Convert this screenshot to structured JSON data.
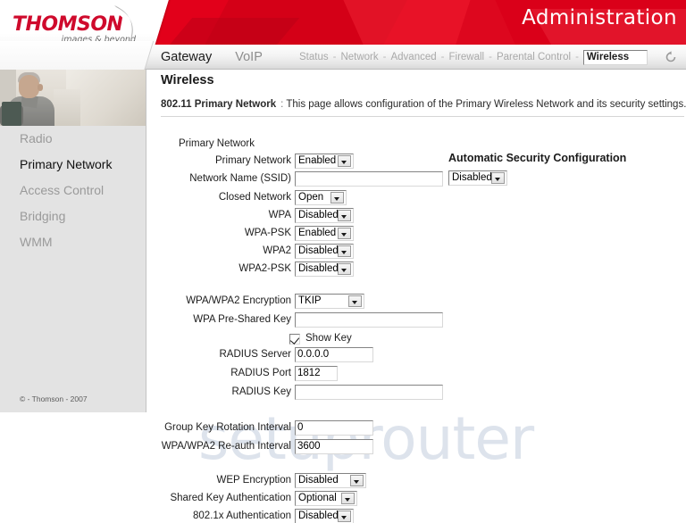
{
  "banner": {
    "logo_word": "THOMSON",
    "logo_tagline": "images & beyond",
    "title": "Administration"
  },
  "nav": {
    "primary": [
      {
        "label": "Gateway",
        "active": true
      },
      {
        "label": "VoIP",
        "active": false
      }
    ],
    "sub": [
      {
        "label": "Status",
        "selected": false
      },
      {
        "label": "Network",
        "selected": false
      },
      {
        "label": "Advanced",
        "selected": false
      },
      {
        "label": "Firewall",
        "selected": false
      },
      {
        "label": "Parental Control",
        "selected": false
      },
      {
        "label": "Wireless",
        "selected": true
      }
    ],
    "separator": "-",
    "reload_icon": "reload-icon"
  },
  "sidebar": {
    "items": [
      {
        "label": "Radio",
        "active": false
      },
      {
        "label": "Primary Network",
        "active": true
      },
      {
        "label": "Access Control",
        "active": false
      },
      {
        "label": "Bridging",
        "active": false
      },
      {
        "label": "WMM",
        "active": false
      }
    ],
    "copyright": "© - Thomson - 2007"
  },
  "main": {
    "title": "Wireless",
    "desc_bold": "802.11 Primary Network",
    "desc_colon": ":",
    "desc_text": "This page allows configuration of the Primary Wireless Network and its security settings.",
    "watermark": "setuprouter",
    "group_label": "Primary Network",
    "fields": [
      {
        "label": "Primary Network",
        "type": "select",
        "value": "Enabled",
        "width": "w66"
      },
      {
        "label": "Network Name (SSID)",
        "type": "text",
        "value": "",
        "width": "w166"
      },
      {
        "label": "Closed Network",
        "type": "select",
        "value": "Open",
        "width": "w58"
      },
      {
        "label": "WPA",
        "type": "select",
        "value": "Disabled",
        "width": "w66"
      },
      {
        "label": "WPA-PSK",
        "type": "select",
        "value": "Enabled",
        "width": "w66"
      },
      {
        "label": "WPA2",
        "type": "select",
        "value": "Disabled",
        "width": "w66"
      },
      {
        "label": "WPA2-PSK",
        "type": "select",
        "value": "Disabled",
        "width": "w66"
      },
      {
        "label": "WPA/WPA2 Encryption",
        "type": "select",
        "value": "TKIP",
        "width": "w78"
      },
      {
        "label": "WPA Pre-Shared Key",
        "type": "text",
        "value": "",
        "width": "w166"
      },
      {
        "label": "RADIUS Server",
        "type": "text",
        "value": "0.0.0.0",
        "width": "w88"
      },
      {
        "label": "RADIUS Port",
        "type": "text",
        "value": "1812",
        "width": "w48"
      },
      {
        "label": "RADIUS Key",
        "type": "text",
        "value": "",
        "width": "w166"
      },
      {
        "label": "Group Key Rotation Interval",
        "type": "text",
        "value": "0",
        "width": "w88"
      },
      {
        "label": "WPA/WPA2 Re-auth Interval",
        "type": "text",
        "value": "3600",
        "width": "w88"
      },
      {
        "label": "WEP Encryption",
        "type": "select",
        "value": "Disabled",
        "width": "w80"
      },
      {
        "label": "Shared Key Authentication",
        "type": "select",
        "value": "Optional",
        "width": "w70"
      },
      {
        "label": "802.1x Authentication",
        "type": "select",
        "value": "Disabled",
        "width": "w66"
      }
    ],
    "show_key": {
      "label": "Show Key",
      "checked": true
    },
    "auto_security": {
      "title": "Automatic Security Configuration",
      "value": "Disabled"
    }
  },
  "colors": {
    "brand_red": "#e2001a",
    "logo_red": "#cf0a2c",
    "sidebar_bg": "#e3e3e3",
    "watermark": "#dde3ec"
  }
}
